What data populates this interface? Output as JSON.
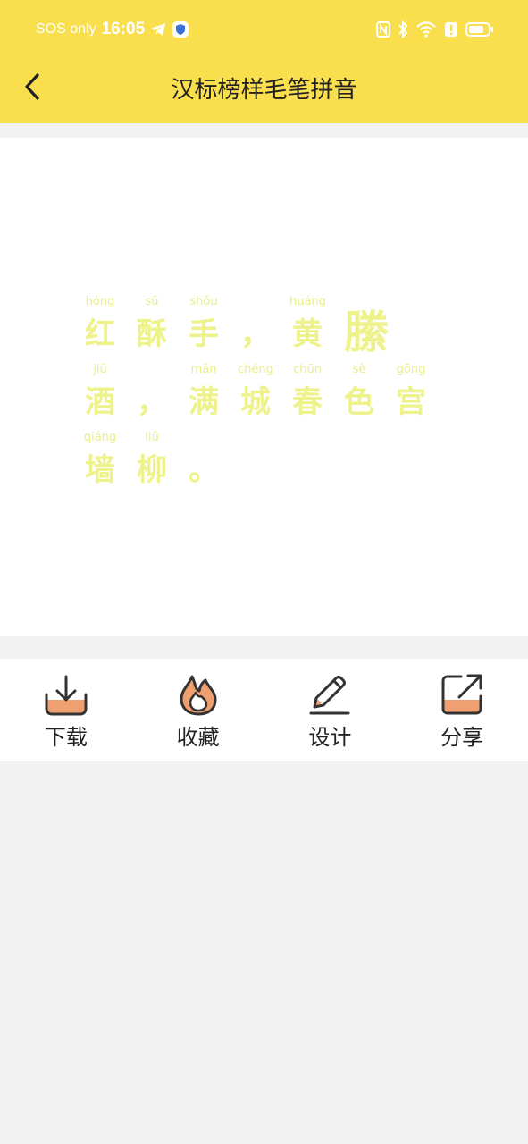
{
  "status_bar": {
    "carrier": "SOS only",
    "time": "16:05"
  },
  "header": {
    "title": "汉标榜样毛笔拼音",
    "background_color": "#f9df4e"
  },
  "poem": {
    "lines": [
      [
        {
          "pinyin": "hóng",
          "hanzi": "红"
        },
        {
          "pinyin": "sū",
          "hanzi": "酥"
        },
        {
          "pinyin": "shǒu",
          "hanzi": "手"
        },
        {
          "pinyin": "",
          "hanzi": "，"
        },
        {
          "pinyin": "huáng",
          "hanzi": "黄"
        },
        {
          "pinyin": "",
          "hanzi": "縢"
        }
      ],
      [
        {
          "pinyin": "jiǔ",
          "hanzi": "酒"
        },
        {
          "pinyin": "",
          "hanzi": "，"
        },
        {
          "pinyin": "mǎn",
          "hanzi": "满"
        },
        {
          "pinyin": "chéng",
          "hanzi": "城"
        },
        {
          "pinyin": "chūn",
          "hanzi": "春"
        },
        {
          "pinyin": "sè",
          "hanzi": "色"
        },
        {
          "pinyin": "gōng",
          "hanzi": "宫"
        }
      ],
      [
        {
          "pinyin": "qiáng",
          "hanzi": "墙"
        },
        {
          "pinyin": "liǔ",
          "hanzi": "柳"
        },
        {
          "pinyin": "",
          "hanzi": "。"
        }
      ]
    ],
    "text_color": "#eef28a"
  },
  "toolbar": {
    "download_label": "下载",
    "favorite_label": "收藏",
    "design_label": "设计",
    "share_label": "分享",
    "accent_color": "#f0a070"
  },
  "icons": {
    "back": "chevron-left-icon",
    "refresh": "refresh-icon",
    "download": "download-icon",
    "favorite": "flame-icon",
    "design": "pencil-icon",
    "share": "share-icon"
  }
}
